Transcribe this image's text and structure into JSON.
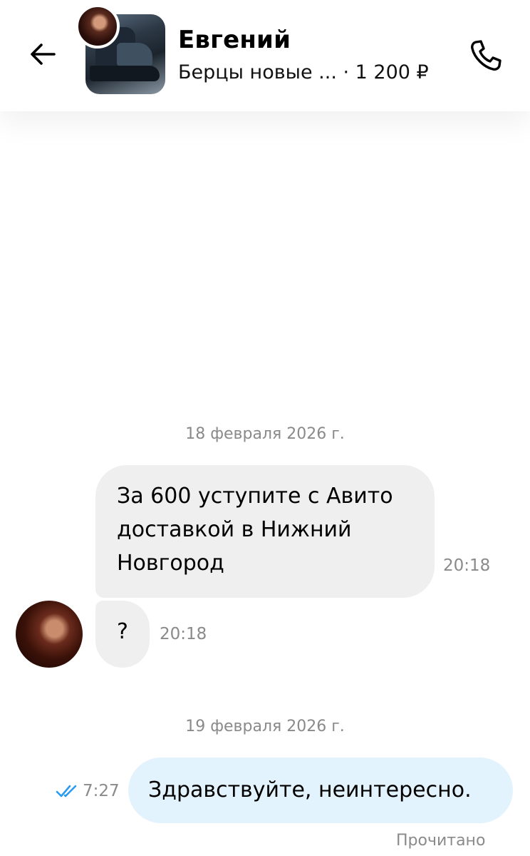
{
  "header": {
    "seller_name": "Евгений",
    "listing_title": "Берцы новые ...",
    "listing_price": "· 1 200 ₽",
    "back_icon": "arrow-left-icon",
    "call_icon": "phone-icon"
  },
  "messages": [
    {
      "date_separator": "18 февраля 2026 г.",
      "items": [
        {
          "direction": "incoming",
          "text": "За 600 уступите с Авито доставкой в Нижний Новгород",
          "time": "20:18"
        },
        {
          "direction": "incoming",
          "text": "?",
          "time": "20:18"
        }
      ]
    },
    {
      "date_separator": "19 февраля 2026 г.",
      "items": [
        {
          "direction": "outgoing",
          "text": "Здравствуйте, неинтересно.",
          "time": "7:27",
          "status": "Прочитано"
        }
      ]
    }
  ],
  "colors": {
    "incoming_bubble": "#efefef",
    "outgoing_bubble": "#e3f3fd",
    "read_check": "#2b9bf0",
    "muted_text": "#8a8a8a"
  }
}
